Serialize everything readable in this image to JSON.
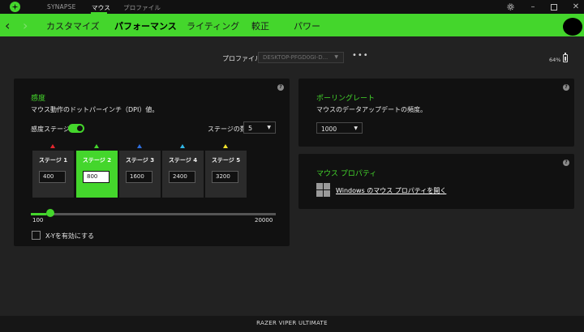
{
  "titlebar": {
    "tabs": [
      "SYNAPSE",
      "マウス",
      "プロファイル"
    ],
    "active_tab": "マウス",
    "controls": {
      "settings": "settings-icon",
      "minimize": "minimize-icon",
      "maximize": "maximize-icon",
      "close": "close-icon"
    }
  },
  "subnav": {
    "tabs": [
      "カスタマイズ",
      "パフォーマンス",
      "ライティング",
      "較正",
      "パワー"
    ],
    "active_tab": "パフォーマンス"
  },
  "profile": {
    "label": "プロファイル",
    "value": "DESKTOP-PFGD0GI-D...",
    "more": "•••"
  },
  "battery": {
    "percent_label": "64%",
    "level": 0.64
  },
  "sensitivity": {
    "title": "感度",
    "description": "マウス動作のドットパーインチ（DPI）値。",
    "stages_toggle_label": "感度ステージ",
    "stages_enabled": true,
    "stage_count_label": "ステージの数",
    "stage_count": "5",
    "stages": [
      {
        "name": "ステージ 1",
        "value": "400",
        "color": "#e3262e"
      },
      {
        "name": "ステージ 2",
        "value": "800",
        "color": "#44d62c",
        "active": true
      },
      {
        "name": "ステージ 3",
        "value": "1600",
        "color": "#2f6fe0"
      },
      {
        "name": "ステージ 4",
        "value": "2400",
        "color": "#31b7e8"
      },
      {
        "name": "ステージ 5",
        "value": "3200",
        "color": "#f0e22c"
      }
    ],
    "slider_min": "100",
    "slider_max": "20000",
    "slider_value": 800,
    "xy_label": "X-Yを有効にする",
    "xy_enabled": false
  },
  "polling": {
    "title": "ポーリングレート",
    "description": "マウスのデータアップデートの頻度。",
    "value": "1000"
  },
  "mouse_properties": {
    "title": "マウス プロパティ",
    "link": "Windows のマウス プロパティを開く"
  },
  "footer": {
    "device": "RAZER VIPER ULTIMATE"
  },
  "colors": {
    "accent": "#44d62c",
    "panel": "#111111",
    "background": "#222222"
  }
}
